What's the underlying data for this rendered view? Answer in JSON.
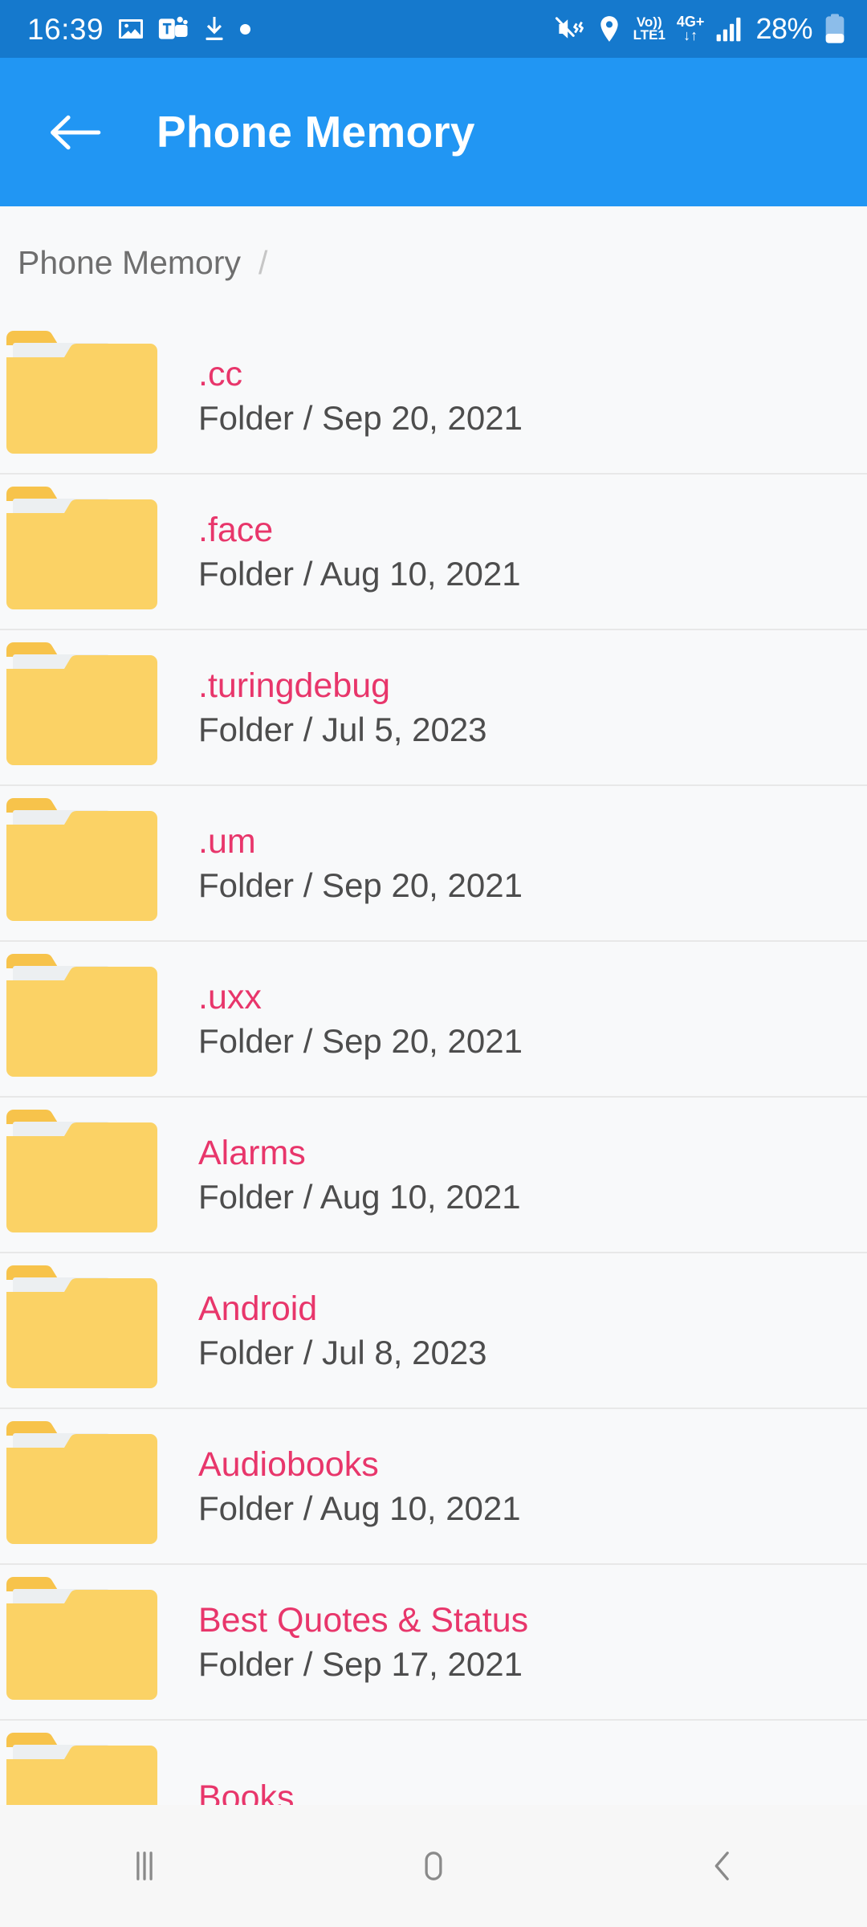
{
  "status_bar": {
    "time": "16:39",
    "left_icons": [
      "image-icon",
      "microsoft-teams-icon",
      "download-icon",
      "dot-indicator-icon"
    ],
    "mute_icon": "mute-vibrate-icon",
    "location_icon": "location-pin-icon",
    "volte_line1": "Vo))",
    "volte_line2": "LTE1",
    "network_line1": "4G+",
    "network_line2": "↓↑",
    "signal_icon": "signal-bars-icon",
    "battery_percent": "28%",
    "battery_icon": "battery-icon",
    "background_color": "#1579CD"
  },
  "app_bar": {
    "back_icon": "back-arrow-icon",
    "title": "Phone Memory",
    "background_color": "#2196F3"
  },
  "breadcrumb": {
    "root_label": "Phone Memory",
    "separator": "/"
  },
  "colors": {
    "folder_name": "#E8366B",
    "folder_meta": "#4D4D4D",
    "folder_yellow": "#FBD265",
    "folder_tab": "#F7C34B",
    "folder_paper": "#ECEFF1",
    "page_background": "#F8F9FA",
    "divider": "#E8E8E8"
  },
  "file_list": {
    "items": [
      {
        "name": ".cc",
        "meta": "Folder / Sep 20, 2021",
        "type": "Folder",
        "date": "Sep 20, 2021",
        "icon": "folder-icon"
      },
      {
        "name": ".face",
        "meta": "Folder / Aug 10, 2021",
        "type": "Folder",
        "date": "Aug 10, 2021",
        "icon": "folder-icon"
      },
      {
        "name": ".turingdebug",
        "meta": "Folder / Jul 5, 2023",
        "type": "Folder",
        "date": "Jul 5, 2023",
        "icon": "folder-icon"
      },
      {
        "name": ".um",
        "meta": "Folder / Sep 20, 2021",
        "type": "Folder",
        "date": "Sep 20, 2021",
        "icon": "folder-icon"
      },
      {
        "name": ".uxx",
        "meta": "Folder / Sep 20, 2021",
        "type": "Folder",
        "date": "Sep 20, 2021",
        "icon": "folder-icon"
      },
      {
        "name": "Alarms",
        "meta": "Folder / Aug 10, 2021",
        "type": "Folder",
        "date": "Aug 10, 2021",
        "icon": "folder-icon"
      },
      {
        "name": "Android",
        "meta": "Folder / Jul 8, 2023",
        "type": "Folder",
        "date": "Jul 8, 2023",
        "icon": "folder-icon"
      },
      {
        "name": "Audiobooks",
        "meta": "Folder / Aug 10, 2021",
        "type": "Folder",
        "date": "Aug 10, 2021",
        "icon": "folder-icon"
      },
      {
        "name": "Best Quotes & Status",
        "meta": "Folder / Sep 17, 2021",
        "type": "Folder",
        "date": "Sep 17, 2021",
        "icon": "folder-icon"
      },
      {
        "name": "Books",
        "meta": "",
        "type": "Folder",
        "date": "",
        "icon": "folder-icon"
      }
    ]
  },
  "nav_bar": {
    "recents_icon": "recents-icon",
    "home_icon": "home-icon",
    "back_icon": "nav-back-icon"
  }
}
